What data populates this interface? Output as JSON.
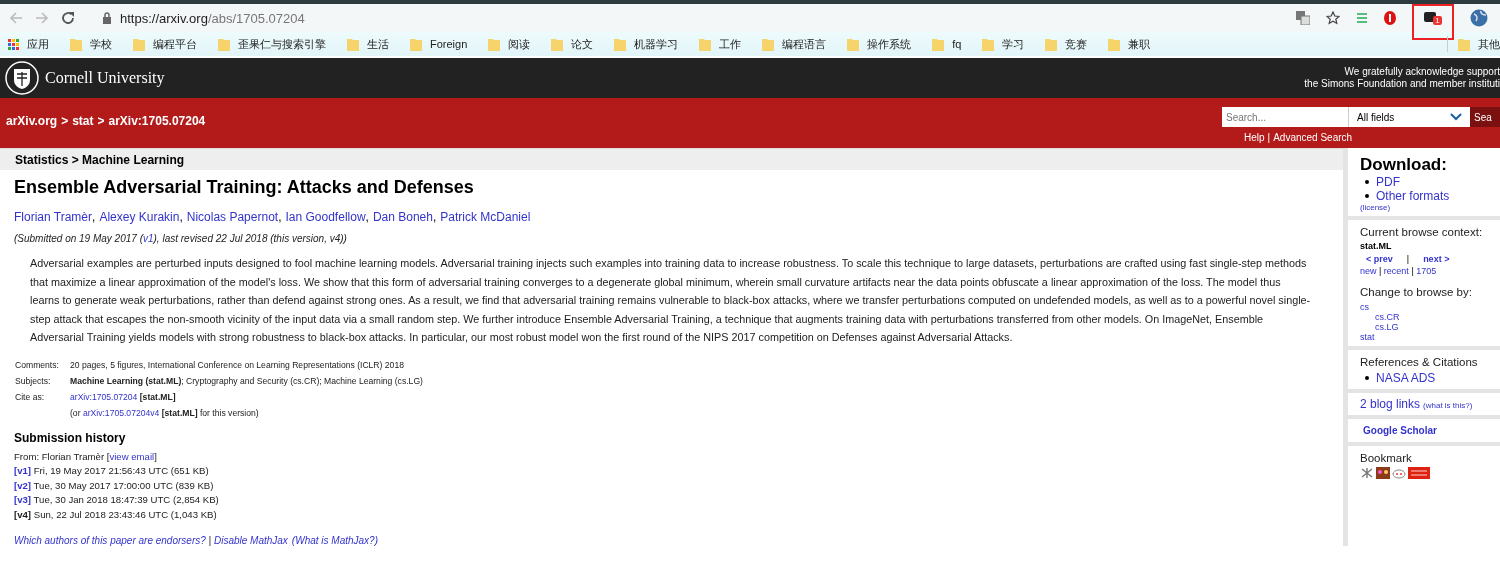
{
  "browser": {
    "url": {
      "host": "https://arxiv.org",
      "path": "/abs/1705.07204"
    },
    "extension_badge": "1",
    "bookmarks": [
      {
        "kind": "apps",
        "label": "应用"
      },
      {
        "kind": "folder",
        "label": "学校"
      },
      {
        "kind": "folder",
        "label": "编程平台"
      },
      {
        "kind": "folder",
        "label": "歪果仁与搜索引擎"
      },
      {
        "kind": "folder",
        "label": "生活"
      },
      {
        "kind": "folder",
        "label": "Foreign"
      },
      {
        "kind": "folder",
        "label": "阅读"
      },
      {
        "kind": "folder",
        "label": "论文"
      },
      {
        "kind": "folder",
        "label": "机器学习"
      },
      {
        "kind": "folder",
        "label": "工作"
      },
      {
        "kind": "folder",
        "label": "编程语言"
      },
      {
        "kind": "folder",
        "label": "操作系统"
      },
      {
        "kind": "folder",
        "label": "fq"
      },
      {
        "kind": "folder",
        "label": "学习"
      },
      {
        "kind": "folder",
        "label": "竞赛"
      },
      {
        "kind": "folder",
        "label": "兼职"
      }
    ],
    "other_bookmarks": "其他"
  },
  "header": {
    "institution": "Cornell University",
    "acknowledgement": [
      "We gratefully acknowledge support",
      "the Simons Foundation and member instituti"
    ]
  },
  "nav": {
    "breadcrumb": [
      "arXiv.org",
      "stat",
      "arXiv:1705.07204"
    ],
    "separator": ">",
    "search": {
      "placeholder": "Search...",
      "field": "All fields",
      "button": "Sea"
    },
    "links": [
      "Help",
      "Advanced Search"
    ],
    "link_separator": "|"
  },
  "subject": "Statistics > Machine Learning",
  "paper": {
    "title": "Ensemble Adversarial Training: Attacks and Defenses",
    "authors": [
      "Florian Tramèr",
      "Alexey Kurakin",
      "Nicolas Papernot",
      "Ian Goodfellow",
      "Dan Boneh",
      "Patrick McDaniel"
    ],
    "author_separator": ",",
    "dateline": [
      {
        "kind": "plain",
        "text": "(Submitted on 19 May 2017 ("
      },
      {
        "kind": "link",
        "text": "v1"
      },
      {
        "kind": "plain",
        "text": "), last revised 22 Jul 2018 (this version, v4))"
      }
    ],
    "abstract": "Adversarial examples are perturbed inputs designed to fool machine learning models. Adversarial training injects such examples into training data to increase robustness. To scale this technique to large datasets, perturbations are crafted using fast single-step methods that maximize a linear approximation of the model's loss. We show that this form of adversarial training converges to a degenerate global minimum, wherein small curvature artifacts near the data points obfuscate a linear approximation of the loss. The model thus learns to generate weak perturbations, rather than defend against strong ones. As a result, we find that adversarial training remains vulnerable to black-box attacks, where we transfer perturbations computed on undefended models, as well as to a powerful novel single-step attack that escapes the non-smooth vicinity of the input data via a small random step. We further introduce Ensemble Adversarial Training, a technique that augments training data with perturbations transferred from other models. On ImageNet, Ensemble Adversarial Training yields models with strong robustness to black-box attacks. In particular, our most robust model won the first round of the NIPS 2017 competition on Defenses against Adversarial Attacks.",
    "metadata": [
      {
        "label": "Comments:",
        "lines": [
          [
            {
              "kind": "plain",
              "text": "20 pages, 5 figures, International Conference on Learning Representations (ICLR) 2018"
            }
          ]
        ]
      },
      {
        "label": "Subjects:",
        "lines": [
          [
            {
              "kind": "bold",
              "text": "Machine Learning (stat.ML)"
            },
            {
              "kind": "plain",
              "text": "; Cryptography and Security (cs.CR); Machine Learning (cs.LG)"
            }
          ]
        ]
      },
      {
        "label": "Cite as:",
        "lines": [
          [
            {
              "kind": "link",
              "text": "arXiv:1705.07204"
            },
            {
              "kind": "bold",
              "text": " [stat.ML]"
            }
          ],
          [
            {
              "kind": "plain",
              "text": "(or "
            },
            {
              "kind": "link",
              "text": "arXiv:1705.07204v4"
            },
            {
              "kind": "bold",
              "text": " [stat.ML]"
            },
            {
              "kind": "plain",
              "text": " for this version)"
            }
          ]
        ]
      }
    ],
    "history": {
      "title": "Submission history",
      "from": [
        {
          "kind": "plain",
          "text": "From: Florian Tramèr ["
        },
        {
          "kind": "link",
          "text": "view email"
        },
        {
          "kind": "plain",
          "text": "]"
        }
      ],
      "versions": [
        {
          "label": "[v1]",
          "link": true,
          "text": "Fri, 19 May 2017 21:56:43 UTC (651 KB)"
        },
        {
          "label": "[v2]",
          "link": true,
          "text": "Tue, 30 May 2017 17:00:00 UTC (839 KB)"
        },
        {
          "label": "[v3]",
          "link": true,
          "text": "Tue, 30 Jan 2018 18:47:39 UTC (2,854 KB)"
        },
        {
          "label": "[v4]",
          "link": false,
          "text": "Sun, 22 Jul 2018 23:43:46 UTC (1,043 KB)"
        }
      ]
    },
    "footer": [
      {
        "kind": "link",
        "text": "Which authors of this paper are endorsers?"
      },
      {
        "kind": "plain",
        "text": " | "
      },
      {
        "kind": "link",
        "text": "Disable MathJax"
      },
      {
        "kind": "link",
        "text": "(What is MathJax?)"
      }
    ]
  },
  "sidebar": {
    "download": {
      "title": "Download:",
      "items": [
        "PDF",
        "Other formats"
      ],
      "note": "(license)"
    },
    "context": {
      "title": "Current browse context:",
      "current": "stat.ML",
      "prev": "< prev",
      "divider": "|",
      "next": "next >",
      "links": [
        "new",
        "recent",
        "1705"
      ],
      "link_separator": "|",
      "change_title": "Change to browse by:",
      "browse": [
        {
          "label": "cs",
          "children": [
            {
              "label": "cs.CR"
            },
            {
              "label": "cs.LG"
            }
          ]
        },
        {
          "label": "stat"
        }
      ]
    },
    "references": {
      "title": "References & Citations",
      "items": [
        "NASA ADS"
      ]
    },
    "blog": {
      "link": "2 blog links",
      "note": "(what is this?)"
    },
    "scholar": "Google Scholar",
    "bookmark": {
      "title": "Bookmark"
    }
  }
}
